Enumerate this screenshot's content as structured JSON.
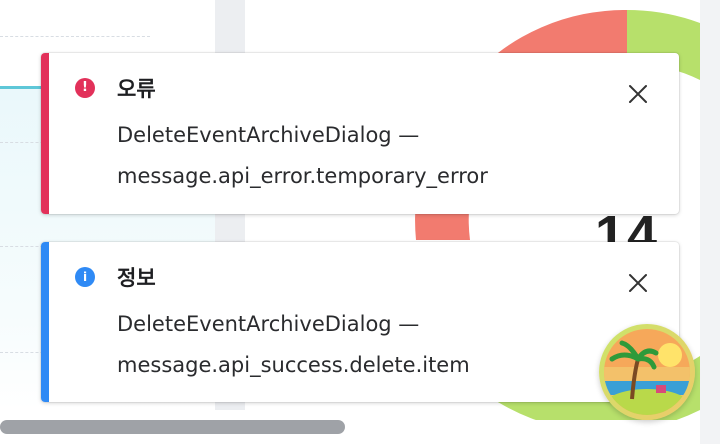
{
  "colors": {
    "error_accent": "#e2315a",
    "info_accent": "#2f8af5",
    "chart_red": "#f27b6f",
    "chart_green": "#b7e06b"
  },
  "toasts": [
    {
      "type": "error",
      "icon": "error-icon",
      "title": "오류",
      "message_line1": "DeleteEventArchiveDialog —",
      "message_line2": "message.api_error.temporary_error",
      "close_icon": "close-icon"
    },
    {
      "type": "info",
      "icon": "info-icon",
      "title": "정보",
      "message_line1": "DeleteEventArchiveDialog —",
      "message_line2": "message.api_success.delete.item",
      "close_icon": "close-icon"
    }
  ],
  "background": {
    "big_number": "14"
  },
  "avatar": {
    "icon": "beach-avatar-icon"
  }
}
